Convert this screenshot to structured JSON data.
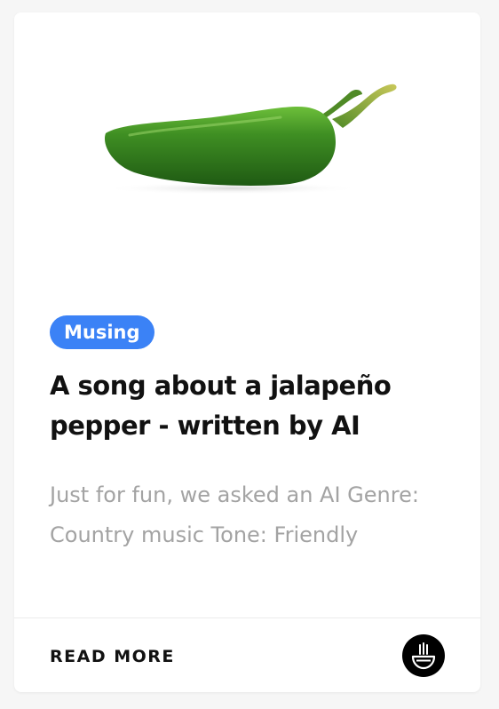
{
  "card": {
    "image": {
      "subject": "green jalapeño pepper",
      "colors": {
        "pepper_dark": "#1f5a13",
        "pepper_mid": "#3f8f23",
        "pepper_light": "#6dbf3a",
        "stem": "#a8b544"
      }
    },
    "category": {
      "label": "Musing",
      "color": "#3b82f6"
    },
    "title": "A song about a jalapeño pepper - written by AI",
    "excerpt": "Just for fun, we asked an AI Genre: Country music Tone: Friendly",
    "footer": {
      "read_more_label": "READ MORE",
      "logo_icon": "bowl-logo-icon"
    }
  }
}
